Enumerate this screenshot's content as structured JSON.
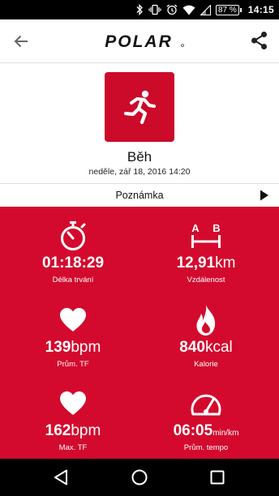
{
  "status_bar": {
    "battery": "87 %",
    "time": "14:15",
    "icons": [
      "bluetooth-icon",
      "vibrate-icon",
      "alarm-icon",
      "wifi-icon",
      "signal-icon",
      "battery-icon"
    ]
  },
  "app_bar": {
    "logo_text": "POLAR",
    "back_icon": "arrow-left-icon",
    "share_icon": "share-icon"
  },
  "session": {
    "sport_name": "Běh",
    "date": "neděle, zář 18, 2016 14:20",
    "sport_icon": "running-figure-icon"
  },
  "note": {
    "label": "Poznámka",
    "icon": "play-arrow-icon"
  },
  "colors": {
    "brand_red": "#d30a2e",
    "icon_red": "#cc0a2a"
  },
  "stats": {
    "duration": {
      "value": "01:18:29",
      "unit": "",
      "label": "Délka trvání",
      "icon": "stopwatch-icon"
    },
    "distance": {
      "value": "12,91",
      "unit": "km",
      "label": "Vzdálenost",
      "icon": "a-b-distance-icon"
    },
    "avg_hr": {
      "value": "139",
      "unit": "bpm",
      "label": "Prům. TF",
      "icon": "heart-icon"
    },
    "calories": {
      "value": "840",
      "unit": "kcal",
      "label": "Kalorie",
      "icon": "flame-icon"
    },
    "max_hr": {
      "value": "162",
      "unit": "bpm",
      "label": "Max. TF",
      "icon": "heart-icon"
    },
    "avg_pace": {
      "value": "06:05",
      "unit": "min/km",
      "label": "Prům. tempo",
      "icon": "speedometer-icon"
    }
  },
  "nav_bar": {
    "icons": [
      "back-triangle-icon",
      "home-circle-icon",
      "recents-square-icon"
    ]
  }
}
